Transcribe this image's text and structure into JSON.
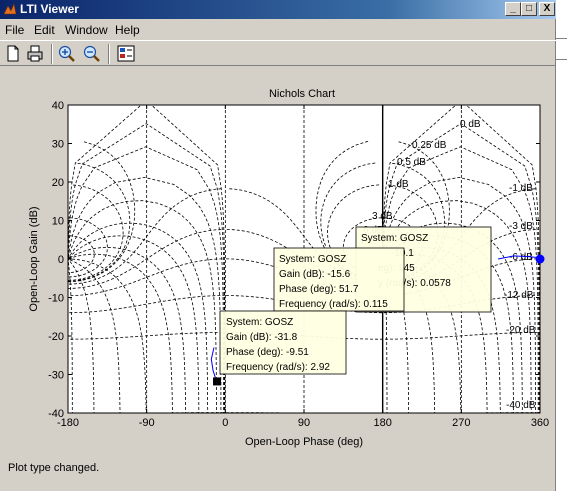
{
  "window": {
    "title": "LTI Viewer",
    "minimize": "_",
    "maximize": "□",
    "close": "X"
  },
  "menu": [
    "File",
    "Edit",
    "Window",
    "Help"
  ],
  "toolbar": {
    "tools": [
      "new-doc",
      "print",
      "zoom-in",
      "zoom-out",
      "plot-config"
    ]
  },
  "chart_data": {
    "type": "line",
    "title": "Nichols Chart",
    "xlabel": "Open-Loop Phase (deg)",
    "ylabel": "Open-Loop Gain (dB)",
    "xlim": [
      -180,
      360
    ],
    "ylim": [
      -40,
      40
    ],
    "xticks": [
      -180,
      -90,
      0,
      90,
      180,
      270,
      360
    ],
    "yticks": [
      -40,
      -30,
      -20,
      -10,
      0,
      10,
      20,
      30,
      40
    ],
    "grid": "nichols",
    "grid_labels": [
      "0 dB",
      "0.25 dB",
      "0.5 dB",
      "1 dB",
      "3 dB",
      "6 dB",
      "-1 dB",
      "-3 dB",
      "-6 dB",
      "-12 dB",
      "-20 dB",
      "-40 dB"
    ],
    "series": [
      {
        "color": "#0000ff",
        "points": [
          [
            -10,
            -31.8
          ],
          [
            -14,
            -29
          ],
          [
            -16,
            -26
          ],
          [
            -13,
            -23
          ]
        ]
      },
      {
        "color": "#0000ff",
        "points": [
          [
            180,
            -8.6
          ],
          [
            180,
            -5
          ],
          [
            180,
            -1
          ]
        ]
      },
      {
        "color": "#0000ff",
        "points": [
          [
            312,
            0
          ],
          [
            330,
            0.8
          ],
          [
            348,
            0.6
          ],
          [
            360,
            0.3
          ]
        ]
      }
    ],
    "markers": [
      {
        "phase": -9.51,
        "gain": -31.8,
        "shape": "square",
        "color": "#000000"
      },
      {
        "phase": 180,
        "gain": -8.6,
        "shape": "circle",
        "color": "#0000ff"
      },
      {
        "phase": 360,
        "gain": 0,
        "shape": "circle",
        "color": "#0000ff"
      },
      {
        "phase": 180,
        "gain": 0,
        "shape": "plus",
        "color": "#ff0000"
      }
    ],
    "datatips": [
      {
        "lines": [
          "System: GOSZ",
          "Gain (dB): -31.8",
          "Phase (deg): -9.51",
          "Frequency (rad/s): 2.92"
        ]
      },
      {
        "lines": [
          "System: GOSZ",
          "Gain (dB): -15.6",
          "Phase (deg): 51.7",
          "Frequency (rad/s): 0.115"
        ]
      },
      {
        "lines": [
          "System: GOSZ",
          "-10.1",
          "eg): 145",
          "y (rad/s): 0.0578"
        ]
      }
    ]
  },
  "status": {
    "text": "Plot type changed."
  }
}
